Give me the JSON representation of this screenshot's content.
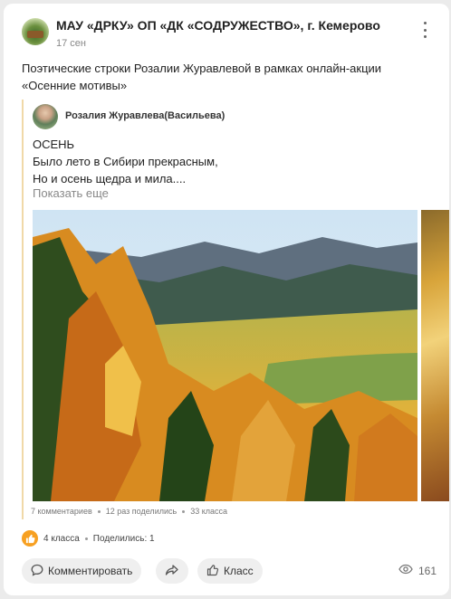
{
  "post": {
    "group_name": "МАУ «ДРКУ» ОП «ДК «СОДРУЖЕСТВО», г. Кемерово",
    "date": "17 сен",
    "text": "Поэтические строки Розалии Журавлевой в рамках онлайн-акции «Осенние мотивы»"
  },
  "repost": {
    "author": "Розалия Журавлева(Васильева)",
    "poem_lines": [
      "ОСЕНЬ",
      "Было лето в Сибири прекрасным,",
      "Но и осень щедра и мила...."
    ],
    "show_more": "Показать еще",
    "stats": {
      "comments": "7 комментариев",
      "shares": "12 раз поделились",
      "likes": "33 класса"
    }
  },
  "reactions": {
    "likes": "4 класса",
    "shares": "Поделились: 1"
  },
  "actions": {
    "comment_label": "Комментировать",
    "like_label": "Класс",
    "views": "161"
  },
  "icons": [
    "more-vertical-icon",
    "like-hand-icon",
    "comment-icon",
    "share-arrow-icon",
    "eye-icon"
  ],
  "colors": {
    "accent": "#f7a021",
    "repost_border": "#f0d9a8",
    "pill_bg": "#efefef"
  }
}
